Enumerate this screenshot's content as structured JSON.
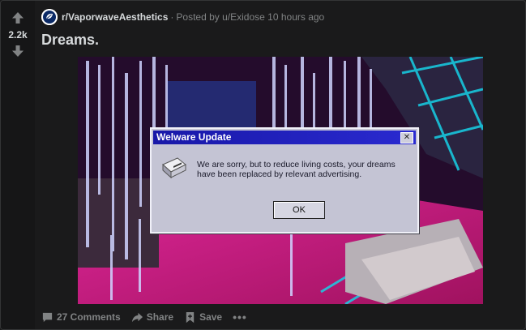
{
  "post": {
    "score": "2.2k",
    "subreddit": "r/VaporwaveAesthetics",
    "separator": "·",
    "posted_by_prefix": "Posted by",
    "username": "u/Exidose",
    "time_ago": "10 hours ago",
    "title": "Dreams."
  },
  "image": {
    "dialog_title": "Welware Update",
    "dialog_close": "✕",
    "dialog_message": "We are sorry, but to reduce living costs, your dreams have been replaced by relevant advertising.",
    "dialog_ok": "OK"
  },
  "actions": {
    "comments": "27 Comments",
    "share": "Share",
    "save": "Save",
    "more": "•••"
  },
  "colors": {
    "background": "#1a1a1b",
    "text": "#d7dadc",
    "muted": "#818384",
    "dialog_titlebar": "#1818a8"
  }
}
